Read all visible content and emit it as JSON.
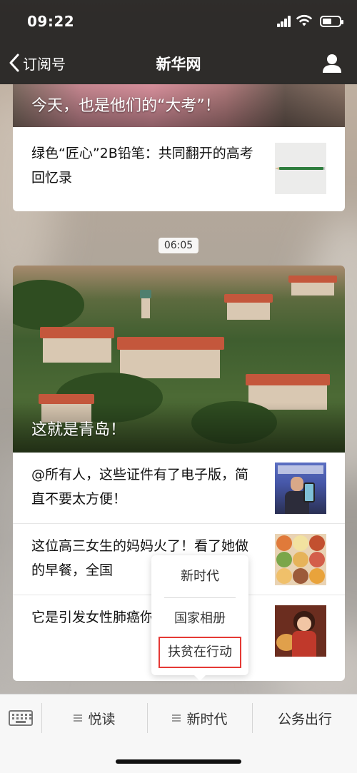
{
  "status_bar": {
    "time": "09:22",
    "battery_level": 0.55
  },
  "nav": {
    "back_label": "订阅号",
    "title": "新华网"
  },
  "card1": {
    "banner_caption": "今天，也是他们的“大考”！",
    "items": [
      {
        "title": "绿色“匠心”2B铅笔：共同翻开的高考回忆录",
        "thumb": "pencil-image"
      }
    ]
  },
  "timestamp": "06:05",
  "card2": {
    "hero_caption": "这就是青岛！",
    "items": [
      {
        "title": "@所有人，这些证件有了电子版，简直不要太方便！",
        "thumb": "person-holding-phone-image"
      },
      {
        "title": "这位高三女生的妈妈火了！看了她做的早餐，全国",
        "thumb": "breakfast-dishes-image"
      },
      {
        "title": "它是引发女性肺癌你家里也有！",
        "thumb": "anime-girl-image"
      }
    ]
  },
  "popup": {
    "items": [
      "新时代",
      "国家相册",
      "扶贫在行动"
    ],
    "highlighted_index": 2
  },
  "bottom_bar": {
    "keyboard_icon": "keyboard-icon",
    "tabs": [
      {
        "label": "悦读",
        "has_menu": true
      },
      {
        "label": "新时代",
        "has_menu": true
      },
      {
        "label": "公务出行",
        "has_menu": false
      }
    ]
  },
  "colors": {
    "highlight_border": "#e53935",
    "nav_bg": "#191919",
    "pencil_green": "#2e7d3d"
  }
}
